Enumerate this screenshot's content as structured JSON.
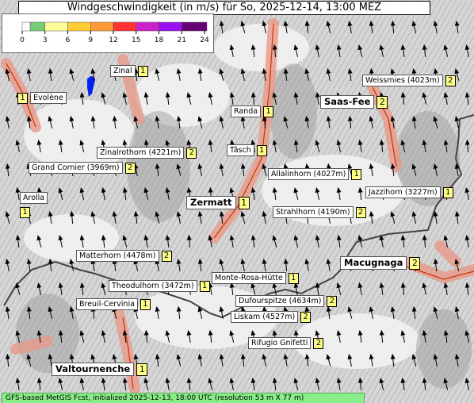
{
  "title": "Windgeschwindigkeit (in m/s) für So, 2025-12-14, 13:00 MEZ",
  "legend": {
    "ticks": [
      "0",
      "3",
      "6",
      "9",
      "12",
      "15",
      "18",
      "21",
      "24"
    ],
    "colors": [
      "#ffffff",
      "#77cc77",
      "#ffff99",
      "#ffcc33",
      "#ff9933",
      "#ff3333",
      "#cc22cc",
      "#9911ee",
      "#660077"
    ]
  },
  "places": [
    {
      "name": "Zinal",
      "value": "1"
    },
    {
      "name": "Evolène",
      "value": "1"
    },
    {
      "name": "Weissmies (4023m)",
      "value": "2"
    },
    {
      "name": "Saas-Fee",
      "value": "2"
    },
    {
      "name": "Randa",
      "value": "1"
    },
    {
      "name": "Täsch",
      "value": "1"
    },
    {
      "name": "Zinalrothorn (4221m)",
      "value": "2"
    },
    {
      "name": "Grand Cornier (3969m)",
      "value": "2"
    },
    {
      "name": "Allalinhorn (4027m)",
      "value": "1"
    },
    {
      "name": "Jazzihorn (3227m)",
      "value": "1"
    },
    {
      "name": "Arolla",
      "value": "1"
    },
    {
      "name": "Zermatt",
      "value": "1"
    },
    {
      "name": "Strahlhorn (4190m)",
      "value": "2"
    },
    {
      "name": "Matterhorn (4478m)",
      "value": "2"
    },
    {
      "name": "Macugnaga",
      "value": "2"
    },
    {
      "name": "Monte-Rosa-Hütte",
      "value": "1"
    },
    {
      "name": "Theodulhorn (3472m)",
      "value": "1"
    },
    {
      "name": "Breuil-Cervinia",
      "value": "1"
    },
    {
      "name": "Dufourspitze (4634m)",
      "value": "2"
    },
    {
      "name": "Liskam (4527m)",
      "value": "2"
    },
    {
      "name": "Rifugio Gnifetti",
      "value": "2"
    },
    {
      "name": "Valtournenche",
      "value": "1"
    }
  ],
  "footer": "GFS-based MetGIS Fcst, initialized 2025-12-13, 18:00 UTC  (resolution 53 m X 77 m)"
}
